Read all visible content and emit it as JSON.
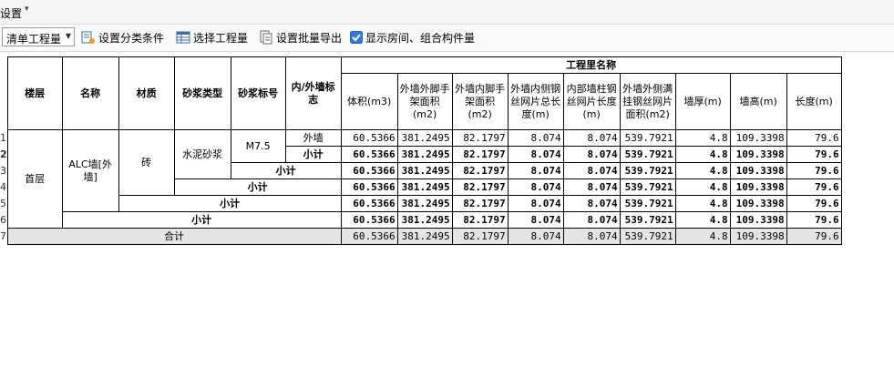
{
  "menubar": {
    "label": "设置"
  },
  "toolbar": {
    "combo_value": "清单工程量",
    "btn_classify": "设置分类条件",
    "btn_select": "选择工程量",
    "btn_export": "设置批量导出",
    "check_label": "显示房间、组合构件量",
    "check_checked": true
  },
  "table": {
    "group_header": "工程里名称",
    "headers": {
      "floor": "楼层",
      "name": "名称",
      "material": "材质",
      "mortar_type": "砂浆类型",
      "mortar_grade": "砂浆标号",
      "inout": "内/外墙标志"
    },
    "qty_headers": [
      "体积(m3)",
      "外墙外脚手架面积(m2)",
      "外墙内脚手架面积(m2)",
      "外墙内侧钢丝网片总长度(m)",
      "内部墙柱钢丝网片长度(m)",
      "外墙外侧满挂钢丝网片面积(m2)",
      "墙厚(m)",
      "墙高(m)",
      "长度(m)"
    ],
    "row_numbers": [
      "1",
      "2",
      "3",
      "4",
      "5",
      "6",
      "7"
    ],
    "cells": {
      "floor": "首层",
      "name": "ALC墙[外墙]",
      "material": "砖",
      "mortar_type": "水泥砂浆",
      "mortar_grade": "M7.5",
      "inout": "外墙",
      "subtotal": "小计",
      "total": "合计"
    },
    "values": [
      "60.5366",
      "381.2495",
      "82.1797",
      "8.074",
      "8.074",
      "539.7921",
      "4.8",
      "109.3398",
      "79.6"
    ]
  }
}
